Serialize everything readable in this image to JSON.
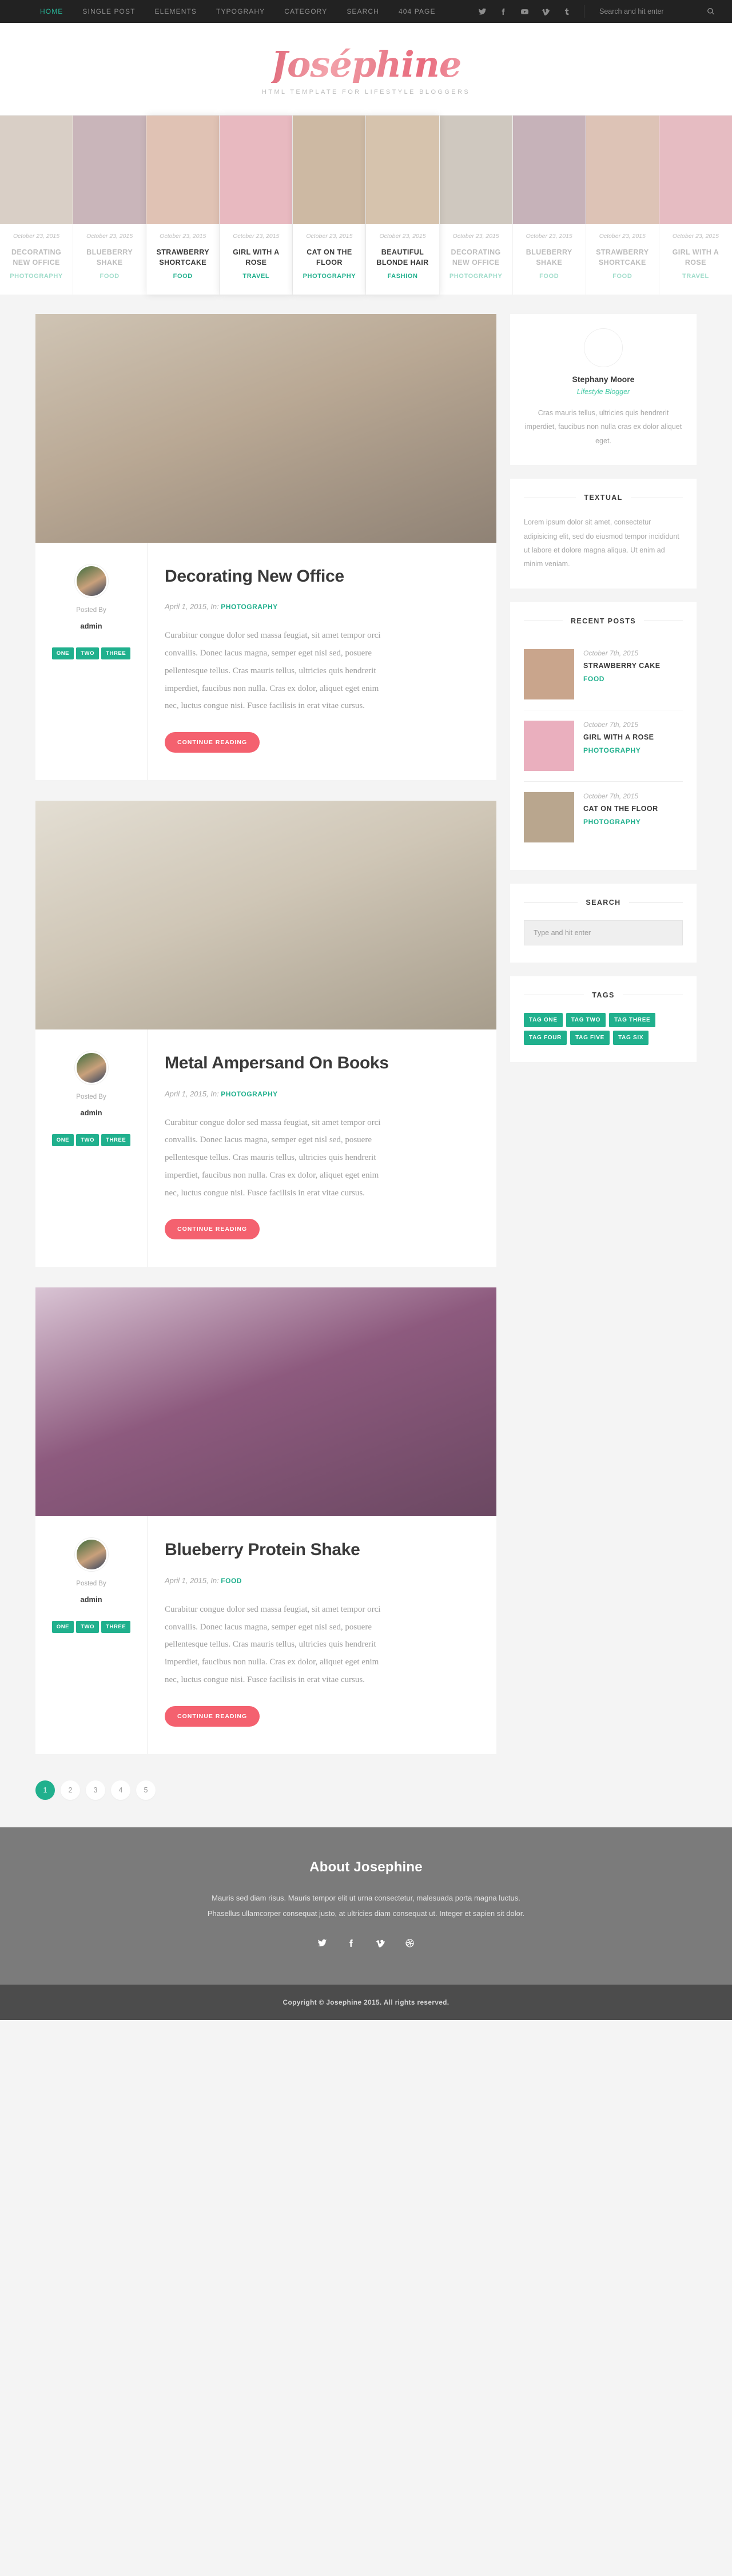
{
  "topbar": {
    "nav": [
      {
        "label": "HOME",
        "active": true
      },
      {
        "label": "SINGLE POST",
        "active": false
      },
      {
        "label": "ELEMENTS",
        "active": false
      },
      {
        "label": "TYPOGRAHY",
        "active": false
      },
      {
        "label": "CATEGORY",
        "active": false
      },
      {
        "label": "SEARCH",
        "active": false
      },
      {
        "label": "404 PAGE",
        "active": false
      }
    ],
    "social": [
      "twitter-icon",
      "facebook-icon",
      "youtube-icon",
      "vimeo-icon",
      "tumblr-icon"
    ],
    "search_placeholder": "Search and hit enter",
    "search_value": ""
  },
  "brand": {
    "logo": "Joséphine",
    "tagline": "HTML TEMPLATE FOR LIFESTYLE BLOGGERS"
  },
  "carousel": [
    {
      "date": "October 23, 2015",
      "title": "DECORATING NEW OFFICE",
      "category": "PHOTOGRAPHY",
      "featured": false,
      "image": "#d9cfc6"
    },
    {
      "date": "October 23, 2015",
      "title": "BLUEBERRY SHAKE",
      "category": "FOOD",
      "featured": false,
      "image": "#c9b5ba"
    },
    {
      "date": "October 23, 2015",
      "title": "STRAWBERRY SHORTCAKE",
      "category": "FOOD",
      "featured": true,
      "image": "#e0c2b4"
    },
    {
      "date": "October 23, 2015",
      "title": "GIRL WITH A ROSE",
      "category": "TRAVEL",
      "featured": true,
      "image": "#e8b9c0"
    },
    {
      "date": "October 23, 2015",
      "title": "CAT ON THE FLOOR",
      "category": "PHOTOGRAPHY",
      "featured": true,
      "image": "#cdb9a3"
    },
    {
      "date": "October 23, 2015",
      "title": "BEAUTIFUL BLONDE HAIR",
      "category": "FASHION",
      "featured": true,
      "image": "#d6c3ad"
    },
    {
      "date": "October 23, 2015",
      "title": "DECORATING NEW OFFICE",
      "category": "PHOTOGRAPHY",
      "featured": false,
      "image": "#cfc8bf"
    },
    {
      "date": "October 23, 2015",
      "title": "BLUEBERRY SHAKE",
      "category": "FOOD",
      "featured": false,
      "image": "#c6b2b9"
    },
    {
      "date": "October 23, 2015",
      "title": "STRAWBERRY SHORTCAKE",
      "category": "FOOD",
      "featured": false,
      "image": "#ddc3b6"
    },
    {
      "date": "October 23, 2015",
      "title": "GIRL WITH A ROSE",
      "category": "TRAVEL",
      "featured": false,
      "image": "#e6bcc2"
    }
  ],
  "posts": [
    {
      "title": "Decorating New Office",
      "date": "April 1, 2015, In:",
      "category": "PHOTOGRAPHY",
      "posted_by_label": "Posted By",
      "author": "admin",
      "tags": [
        "ONE",
        "TWO",
        "THREE"
      ],
      "excerpt": "Curabitur congue dolor sed massa feugiat, sit amet tempor orci convallis. Donec lacus magna, semper eget nisl sed, posuere pellentesque tellus. Cras mauris tellus, ultricies quis hendrerit imperdiet, faucibus non nulla. Cras ex dolor, aliquet eget enim nec, luctus congue nisi. Fusce facilisis in erat vitae cursus.",
      "button": "CONTINUE READING",
      "image_tone": "office"
    },
    {
      "title": "Metal Ampersand On Books",
      "date": "April 1, 2015, In:",
      "category": "PHOTOGRAPHY",
      "posted_by_label": "Posted By",
      "author": "admin",
      "tags": [
        "ONE",
        "TWO",
        "THREE"
      ],
      "excerpt": "Curabitur congue dolor sed massa feugiat, sit amet tempor orci convallis. Donec lacus magna, semper eget nisl sed, posuere pellentesque tellus. Cras mauris tellus, ultricies quis hendrerit imperdiet, faucibus non nulla. Cras ex dolor, aliquet eget enim nec, luctus congue nisi. Fusce facilisis in erat vitae cursus.",
      "button": "CONTINUE READING",
      "image_tone": "ampersand"
    },
    {
      "title": "Blueberry Protein Shake",
      "date": "April 1, 2015, In:",
      "category": "FOOD",
      "posted_by_label": "Posted By",
      "author": "admin",
      "tags": [
        "ONE",
        "TWO",
        "THREE"
      ],
      "excerpt": "Curabitur congue dolor sed massa feugiat, sit amet tempor orci convallis. Donec lacus magna, semper eget nisl sed, posuere pellentesque tellus. Cras mauris tellus, ultricies quis hendrerit imperdiet, faucibus non nulla. Cras ex dolor, aliquet eget enim nec, luctus congue nisi. Fusce facilisis in erat vitae cursus.",
      "button": "CONTINUE READING",
      "image_tone": "shake"
    }
  ],
  "sidebar": {
    "author": {
      "name": "Stephany Moore",
      "role": "Lifestyle Blogger",
      "description": "Cras mauris tellus, ultricies quis hendrerit imperdiet, faucibus non nulla cras ex dolor aliquet eget."
    },
    "textual": {
      "title": "TEXTUAL",
      "body": "Lorem ipsum dolor sit amet, consectetur adipisicing elit, sed do eiusmod tempor incididunt ut labore et dolore magna aliqua. Ut enim ad minim veniam."
    },
    "recent_posts": {
      "title": "RECENT POSTS",
      "items": [
        {
          "date": "October 7th, 2015",
          "title": "STRAWBERRY CAKE",
          "category": "FOOD",
          "tone": "#c9a58c"
        },
        {
          "date": "October 7th, 2015",
          "title": "GIRL WITH A ROSE",
          "category": "PHOTOGRAPHY",
          "tone": "#eaafbe"
        },
        {
          "date": "October 7th, 2015",
          "title": "CAT ON THE FLOOR",
          "category": "PHOTOGRAPHY",
          "tone": "#b9a68e"
        }
      ]
    },
    "search": {
      "title": "SEARCH",
      "placeholder": "Type and hit enter",
      "value": ""
    },
    "tags": {
      "title": "TAGS",
      "items": [
        "TAG ONE",
        "TAG TWO",
        "TAG THREE",
        "TAG FOUR",
        "TAG FIVE",
        "TAG SIX"
      ]
    }
  },
  "pagination": {
    "pages": [
      "1",
      "2",
      "3",
      "4",
      "5"
    ],
    "current": "1"
  },
  "footer": {
    "title": "About Josephine",
    "description": "Mauris sed diam risus. Mauris tempor elit ut urna consectetur, malesuada porta magna luctus. Phasellus ullamcorper consequat justo, at ultricies diam consequat ut. Integer et sapien sit dolor.",
    "social": [
      "twitter-icon",
      "facebook-icon",
      "vimeo-icon",
      "dribbble-icon"
    ],
    "copyright": "Copyright © Josephine 2015. All rights reserved."
  },
  "colors": {
    "accent_teal": "#20b08d",
    "accent_pink": "#f4616f",
    "nav_bg": "#222222",
    "footer_bg": "#7b7b7b",
    "copyright_bg": "#4c4c4c"
  }
}
